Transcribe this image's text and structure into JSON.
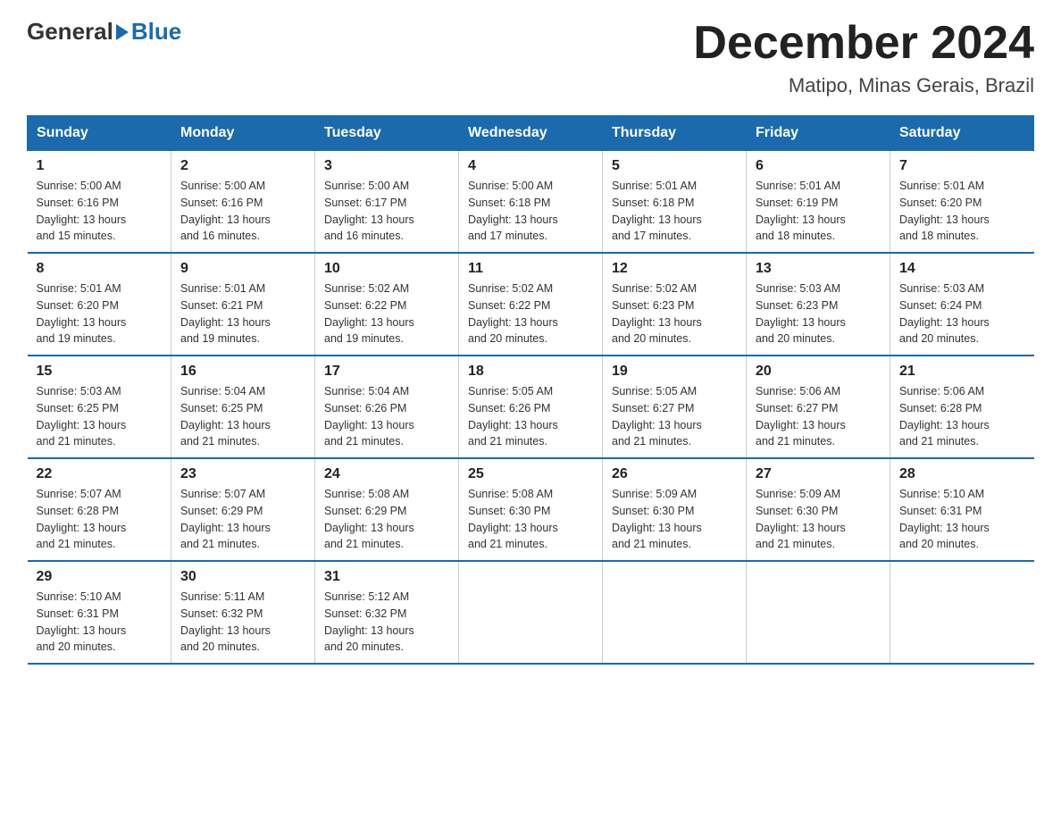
{
  "header": {
    "logo": {
      "general": "General",
      "blue": "Blue"
    },
    "title": "December 2024",
    "subtitle": "Matipo, Minas Gerais, Brazil"
  },
  "days_of_week": [
    "Sunday",
    "Monday",
    "Tuesday",
    "Wednesday",
    "Thursday",
    "Friday",
    "Saturday"
  ],
  "weeks": [
    [
      {
        "day": "1",
        "sunrise": "5:00 AM",
        "sunset": "6:16 PM",
        "daylight": "13 hours and 15 minutes."
      },
      {
        "day": "2",
        "sunrise": "5:00 AM",
        "sunset": "6:16 PM",
        "daylight": "13 hours and 16 minutes."
      },
      {
        "day": "3",
        "sunrise": "5:00 AM",
        "sunset": "6:17 PM",
        "daylight": "13 hours and 16 minutes."
      },
      {
        "day": "4",
        "sunrise": "5:00 AM",
        "sunset": "6:18 PM",
        "daylight": "13 hours and 17 minutes."
      },
      {
        "day": "5",
        "sunrise": "5:01 AM",
        "sunset": "6:18 PM",
        "daylight": "13 hours and 17 minutes."
      },
      {
        "day": "6",
        "sunrise": "5:01 AM",
        "sunset": "6:19 PM",
        "daylight": "13 hours and 18 minutes."
      },
      {
        "day": "7",
        "sunrise": "5:01 AM",
        "sunset": "6:20 PM",
        "daylight": "13 hours and 18 minutes."
      }
    ],
    [
      {
        "day": "8",
        "sunrise": "5:01 AM",
        "sunset": "6:20 PM",
        "daylight": "13 hours and 19 minutes."
      },
      {
        "day": "9",
        "sunrise": "5:01 AM",
        "sunset": "6:21 PM",
        "daylight": "13 hours and 19 minutes."
      },
      {
        "day": "10",
        "sunrise": "5:02 AM",
        "sunset": "6:22 PM",
        "daylight": "13 hours and 19 minutes."
      },
      {
        "day": "11",
        "sunrise": "5:02 AM",
        "sunset": "6:22 PM",
        "daylight": "13 hours and 20 minutes."
      },
      {
        "day": "12",
        "sunrise": "5:02 AM",
        "sunset": "6:23 PM",
        "daylight": "13 hours and 20 minutes."
      },
      {
        "day": "13",
        "sunrise": "5:03 AM",
        "sunset": "6:23 PM",
        "daylight": "13 hours and 20 minutes."
      },
      {
        "day": "14",
        "sunrise": "5:03 AM",
        "sunset": "6:24 PM",
        "daylight": "13 hours and 20 minutes."
      }
    ],
    [
      {
        "day": "15",
        "sunrise": "5:03 AM",
        "sunset": "6:25 PM",
        "daylight": "13 hours and 21 minutes."
      },
      {
        "day": "16",
        "sunrise": "5:04 AM",
        "sunset": "6:25 PM",
        "daylight": "13 hours and 21 minutes."
      },
      {
        "day": "17",
        "sunrise": "5:04 AM",
        "sunset": "6:26 PM",
        "daylight": "13 hours and 21 minutes."
      },
      {
        "day": "18",
        "sunrise": "5:05 AM",
        "sunset": "6:26 PM",
        "daylight": "13 hours and 21 minutes."
      },
      {
        "day": "19",
        "sunrise": "5:05 AM",
        "sunset": "6:27 PM",
        "daylight": "13 hours and 21 minutes."
      },
      {
        "day": "20",
        "sunrise": "5:06 AM",
        "sunset": "6:27 PM",
        "daylight": "13 hours and 21 minutes."
      },
      {
        "day": "21",
        "sunrise": "5:06 AM",
        "sunset": "6:28 PM",
        "daylight": "13 hours and 21 minutes."
      }
    ],
    [
      {
        "day": "22",
        "sunrise": "5:07 AM",
        "sunset": "6:28 PM",
        "daylight": "13 hours and 21 minutes."
      },
      {
        "day": "23",
        "sunrise": "5:07 AM",
        "sunset": "6:29 PM",
        "daylight": "13 hours and 21 minutes."
      },
      {
        "day": "24",
        "sunrise": "5:08 AM",
        "sunset": "6:29 PM",
        "daylight": "13 hours and 21 minutes."
      },
      {
        "day": "25",
        "sunrise": "5:08 AM",
        "sunset": "6:30 PM",
        "daylight": "13 hours and 21 minutes."
      },
      {
        "day": "26",
        "sunrise": "5:09 AM",
        "sunset": "6:30 PM",
        "daylight": "13 hours and 21 minutes."
      },
      {
        "day": "27",
        "sunrise": "5:09 AM",
        "sunset": "6:30 PM",
        "daylight": "13 hours and 21 minutes."
      },
      {
        "day": "28",
        "sunrise": "5:10 AM",
        "sunset": "6:31 PM",
        "daylight": "13 hours and 20 minutes."
      }
    ],
    [
      {
        "day": "29",
        "sunrise": "5:10 AM",
        "sunset": "6:31 PM",
        "daylight": "13 hours and 20 minutes."
      },
      {
        "day": "30",
        "sunrise": "5:11 AM",
        "sunset": "6:32 PM",
        "daylight": "13 hours and 20 minutes."
      },
      {
        "day": "31",
        "sunrise": "5:12 AM",
        "sunset": "6:32 PM",
        "daylight": "13 hours and 20 minutes."
      },
      null,
      null,
      null,
      null
    ]
  ],
  "labels": {
    "sunrise": "Sunrise:",
    "sunset": "Sunset:",
    "daylight": "Daylight:"
  }
}
